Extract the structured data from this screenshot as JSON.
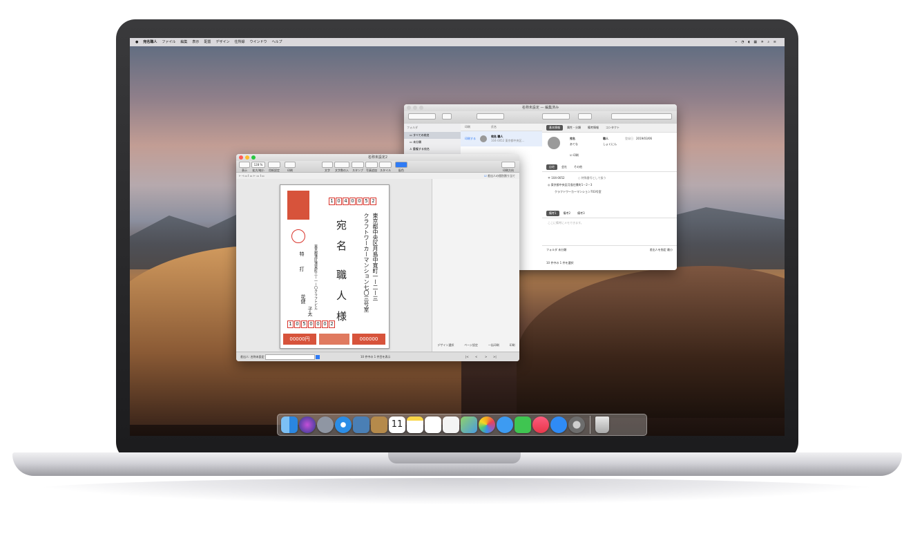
{
  "menubar": {
    "items": [
      "宛名職人",
      "ファイル",
      "編集",
      "表示",
      "配置",
      "デザイン",
      "住所録",
      "ウインドウ",
      "ヘルプ"
    ],
    "status_icons": "⌁ ◔ ◖ ▦ ✳ ⌕ ≡"
  },
  "address_window": {
    "title": "名称未設定 — 編集済み",
    "sidebar_header": "フォルダ",
    "folders": [
      "すべての宛名",
      "未分類",
      "重複する宛名"
    ],
    "list_header_a": "印刷",
    "list_header_b": "氏名",
    "list_row_label": "印刷する",
    "list_name": "宛名 職人",
    "list_addr": "104-0052 東京都中央区…",
    "tabs": [
      "基本情報",
      "属性・分類",
      "備考情報",
      "コンタクト"
    ],
    "name_label": "宛名",
    "name_value": "職人",
    "reading_a": "あてな",
    "reading_b": "しょくにん",
    "date_label": "登録日",
    "date_value": "2019/03/06",
    "print_label": "印刷",
    "addr_tabs": [
      "自宅",
      "会社",
      "その他"
    ],
    "postal": "104-0052",
    "special_label": "特殊番号として扱う",
    "address1": "東京都中央区月島住貫町1－2－3",
    "address2": "クラフトワーカーマンション703号室",
    "memo_tabs": [
      "備考1",
      "備考2",
      "備考3"
    ],
    "memo_placeholder": "ここに備考にメモできます。",
    "footer_left": "フォルダ  未分類",
    "footer_status": "10 件中の 1 件を選択",
    "footer_right": "差出人を指定 最小"
  },
  "card_window": {
    "title": "名称未設定2",
    "toolbar": [
      "表示",
      "拡大/縮小",
      "用紙設定",
      "印刷",
      "文字",
      "文字数の入力",
      "スタンプ",
      "写真追加",
      "スタイル",
      "配色",
      "印刷方向",
      "差出人の個別割り当て"
    ],
    "zoom": "128 %",
    "sender_individual": "差出人の個別割り当て",
    "postcode_to": [
      "1",
      "0",
      "4",
      "0",
      "0",
      "5",
      "2"
    ],
    "address_line1": "東京都中央区月島中寛町一ー二ー三",
    "address_line2": "クラフトワーカーマンション七〇三号室",
    "recipient_name_a": "宛",
    "recipient_name_b": "名",
    "recipient_given_a": "職",
    "recipient_given_b": "人",
    "honorific": "様",
    "sender_addr": "東京都港区港東町三ー一ー〇クラフトビル",
    "sender_name1": "特",
    "sender_name2": "打",
    "sender_name3": "花健",
    "sender_name4": "子太",
    "postcode_from": [
      "1",
      "0",
      "5",
      "0",
      "0",
      "0",
      "2"
    ],
    "stamp_left": "00000円",
    "stamp_right": "000000",
    "side_tabs": [
      "デザイン選択",
      "ページ設定",
      "一括印刷",
      "印刷"
    ],
    "footer_left": "差出人: 名称未設定",
    "footer_status": "10 件中の 1 件目を表示",
    "nav": [
      "|<",
      "<",
      ">",
      ">|"
    ]
  },
  "dock": {
    "icons": [
      "finder-icon",
      "siri-icon",
      "launchpad-icon",
      "safari-icon",
      "photo-viewer-icon",
      "contacts-icon",
      "calendar-icon",
      "notes-icon",
      "reminders-icon",
      "sketch-icon",
      "maps-icon",
      "photos-icon",
      "messages-icon",
      "facetime-icon",
      "music-icon",
      "app-store-icon",
      "system-preferences-icon",
      "trash-icon"
    ],
    "calendar_day": "11"
  },
  "colors": {
    "postal_red": "#d9342b",
    "stamp_red": "#d7533b",
    "accent_blue": "#2f7bf5"
  }
}
